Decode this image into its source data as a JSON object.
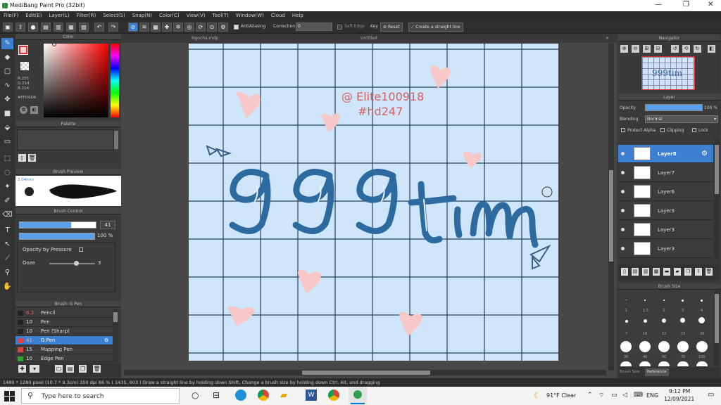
{
  "titlebar": {
    "title": "MediBang Paint Pro (32bit)",
    "minimize": "—",
    "maximize": "❐",
    "close": "✕"
  },
  "menu": [
    "File(F)",
    "Edit(E)",
    "Layer(L)",
    "Filter(R)",
    "Select(S)",
    "Snap(N)",
    "Color(C)",
    "View(V)",
    "Tool(T)",
    "Window(W)",
    "Cloud",
    "Help"
  ],
  "toolbar": {
    "antialiasing": "AntiAliasing",
    "correction_label": "Correction",
    "correction_value": "0",
    "soft_edge": "Soft Edge",
    "key_label": "Key",
    "reset": "Reset",
    "straight_line": "Create a straight line"
  },
  "color_panel": {
    "title": "Color",
    "r": "R:255",
    "g": "G:214",
    "b": "B:214",
    "hex": "#FFD6D6",
    "fg": "#ffd6d6"
  },
  "palette_panel": {
    "title": "Palette"
  },
  "brush_preview": {
    "title": "Brush Preview",
    "size": "3.04mm"
  },
  "brush_control": {
    "title": "Brush Control",
    "size_value": "41",
    "opacity_value": "100 %",
    "opacity_by_pressure": "Opacity by Pressure",
    "ooze_label": "Ooze",
    "ooze_value": "3"
  },
  "brush_list": {
    "title": "Brush: G Pen",
    "items": [
      {
        "size": "6.3",
        "name": "Pencil",
        "color": "#222222"
      },
      {
        "size": "10",
        "name": "Pen",
        "color": "#222222"
      },
      {
        "size": "10",
        "name": "Pen (Sharp)",
        "color": "#222222"
      },
      {
        "size": "41",
        "name": "G Pen",
        "color": "#e04040"
      },
      {
        "size": "15",
        "name": "Mapping Pen",
        "color": "#e04040"
      },
      {
        "size": "10",
        "name": "Edge Pen",
        "color": "#30a030"
      }
    ]
  },
  "documents": {
    "tab1": "Ngocha.mdp",
    "tab2": "Untitled"
  },
  "canvas": {
    "watermark1": "@ Elite100918",
    "watermark2": "#hd247",
    "title_art": "999tim"
  },
  "navigator": {
    "title": "Navigator",
    "thumb_text": "999tim"
  },
  "layer_panel": {
    "title": "Layer",
    "opacity_label": "Opacity",
    "opacity_value": "100 %",
    "blending_label": "Blending",
    "blending_value": "Normal",
    "protect_alpha": "Protect Alpha",
    "clipping": "Clipping",
    "lock": "Lock",
    "layers": [
      "Layer8",
      "Layer7",
      "Layer6",
      "Layer3",
      "Layer3",
      "Layer3"
    ]
  },
  "brush_size_panel": {
    "title": "Brush Size",
    "small_labels": [
      "1",
      "1.5",
      "2",
      "3",
      "4"
    ],
    "mid_labels": [
      "7",
      "10",
      "12",
      "15",
      "20"
    ],
    "big_labels": [
      "30",
      "40",
      "50",
      "70",
      "100"
    ],
    "tab1": "Brush Size",
    "tab2": "Reference"
  },
  "statusbar": {
    "text": "1480 * 1280 pixel  (10.7 * 9.3cm)  350 dpi  66 %  ( 1435, 603 )  Draw a straight line by holding down Shift, Change a brush size by holding down Ctrl, Alt, and dragging"
  },
  "taskbar": {
    "search_placeholder": "Type here to search",
    "weather": "91°F  Clear",
    "lang": "ENG",
    "time": "9:12 PM",
    "date": "12/09/2021"
  }
}
